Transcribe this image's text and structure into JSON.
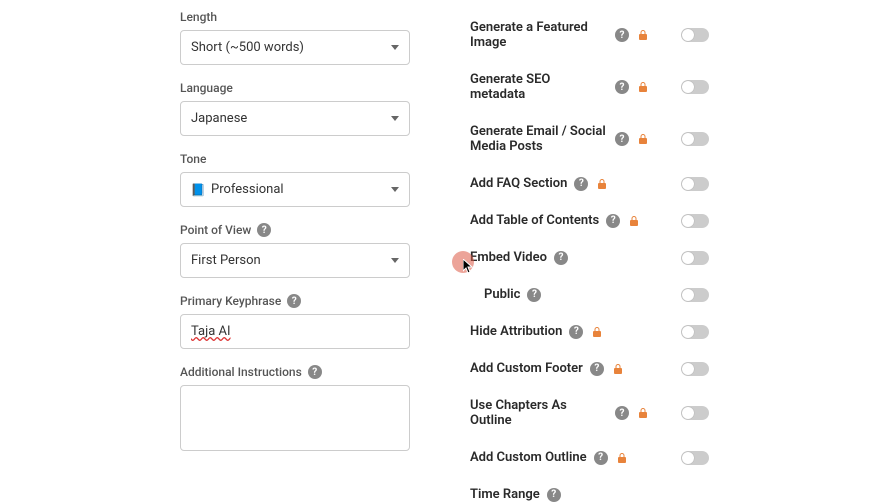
{
  "left": {
    "length": {
      "label": "Length",
      "value": "Short (~500 words)"
    },
    "language": {
      "label": "Language",
      "value": "Japanese"
    },
    "tone": {
      "label": "Tone",
      "value": "Professional"
    },
    "pov": {
      "label": "Point of View",
      "value": "First Person"
    },
    "keyphrase": {
      "label": "Primary Keyphrase",
      "value": "Taja AI"
    },
    "instructions": {
      "label": "Additional Instructions",
      "value": ""
    }
  },
  "right": {
    "featuredImage": "Generate a Featured Image",
    "seoMetadata": "Generate SEO metadata",
    "emailSocial": "Generate Email / Social Media Posts",
    "faq": "Add FAQ Section",
    "toc": "Add Table of Contents",
    "embedVideo": "Embed Video",
    "public": "Public",
    "hideAttribution": "Hide Attribution",
    "customFooter": "Add Custom Footer",
    "chaptersOutline": "Use Chapters As Outline",
    "customOutline": "Add Custom Outline",
    "timeRange": "Time Range"
  },
  "icons": {
    "help": "?",
    "professional": "📘"
  }
}
